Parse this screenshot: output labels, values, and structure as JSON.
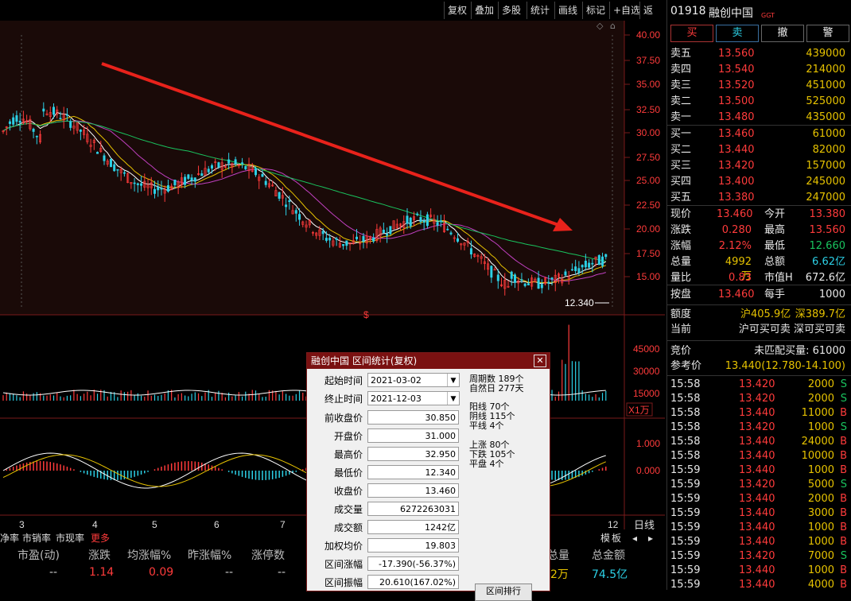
{
  "toolbar": {
    "items": [
      "复权",
      "叠加",
      "多股",
      "统计",
      "画线",
      "标记",
      "+自选",
      "返回"
    ]
  },
  "chart": {
    "price_axis": [
      "40.00",
      "37.50",
      "35.00",
      "32.50",
      "30.00",
      "27.50",
      "25.00",
      "22.50",
      "20.00",
      "17.50",
      "15.00"
    ],
    "last_price_label": "12.340",
    "marker": "$",
    "volume_axis": [
      "45000",
      "30000",
      "15000"
    ],
    "volume_unit": "X1万",
    "macd_axis": [
      "1.000",
      "0.000"
    ],
    "x_axis": [
      "3",
      "4",
      "5",
      "6",
      "7",
      "12"
    ],
    "period_label": "日线",
    "colors": {
      "up": "#ff3b3b",
      "down": "#2cd0e6",
      "ma5": "#ffffff",
      "ma10": "#e6c200",
      "ma20": "#c040c0",
      "ma60": "#19c35e"
    }
  },
  "bottom": {
    "tabs": [
      "净率",
      "市销率",
      "市现率",
      "更多"
    ],
    "right_tabs": [
      "模",
      "板"
    ],
    "headers": [
      "市盈(动)",
      "涨跌",
      "均涨幅%",
      "昨涨幅%",
      "涨停数",
      "总量",
      "总金额"
    ],
    "values": [
      "--",
      "1.14",
      "0.09",
      "--",
      "--",
      "2万",
      "74.5亿"
    ]
  },
  "dialog": {
    "title": "融创中国 区间统计(复权)",
    "start_label": "起始时间",
    "start_value": "2021-03-02",
    "end_label": "终止时间",
    "end_value": "2021-12-03",
    "rows": [
      {
        "label": "前收盘价",
        "value": "30.850"
      },
      {
        "label": "开盘价",
        "value": "31.000"
      },
      {
        "label": "最高价",
        "value": "32.950"
      },
      {
        "label": "最低价",
        "value": "12.340"
      },
      {
        "label": "收盘价",
        "value": "13.460"
      },
      {
        "label": "成交量",
        "value": "6272263031"
      },
      {
        "label": "成交额",
        "value": "1242亿"
      },
      {
        "label": "加权均价",
        "value": "19.803"
      },
      {
        "label": "区间涨幅",
        "value": "-17.390(-56.37%)"
      },
      {
        "label": "区间振幅",
        "value": "20.610(167.02%)"
      }
    ],
    "stats1": [
      "周期数 189个",
      "自然日 277天"
    ],
    "stats2": [
      "阳线 70个",
      "阴线 115个",
      "平线 4个"
    ],
    "stats3": [
      "上涨 80个",
      "下跌 105个",
      "平盘 4个"
    ],
    "button": "区间排行"
  },
  "right": {
    "code": "01918",
    "name": "融创中国",
    "tag": "GGT",
    "buttons": [
      "买",
      "卖",
      "撤",
      "警"
    ],
    "asks": [
      {
        "label": "卖五",
        "price": "13.560",
        "vol": "439000"
      },
      {
        "label": "卖四",
        "price": "13.540",
        "vol": "214000"
      },
      {
        "label": "卖三",
        "price": "13.520",
        "vol": "451000"
      },
      {
        "label": "卖二",
        "price": "13.500",
        "vol": "525000"
      },
      {
        "label": "卖一",
        "price": "13.480",
        "vol": "435000"
      }
    ],
    "bids": [
      {
        "label": "买一",
        "price": "13.460",
        "vol": "61000"
      },
      {
        "label": "买二",
        "price": "13.440",
        "vol": "82000"
      },
      {
        "label": "买三",
        "price": "13.420",
        "vol": "157000"
      },
      {
        "label": "买四",
        "price": "13.400",
        "vol": "245000"
      },
      {
        "label": "买五",
        "price": "13.380",
        "vol": "247000"
      }
    ],
    "quote": [
      {
        "l1": "现价",
        "v1": "13.460",
        "l2": "今开",
        "v2": "13.380"
      },
      {
        "l1": "涨跌",
        "v1": "0.280",
        "l2": "最高",
        "v2": "13.560"
      },
      {
        "l1": "涨幅",
        "v1": "2.12%",
        "l2": "最低",
        "v2": "12.660"
      },
      {
        "l1": "总量",
        "v1": "4992万",
        "l2": "总额",
        "v2": "6.62亿"
      },
      {
        "l1": "量比",
        "v1": "0.83",
        "l2": "市值H",
        "v2": "672.6亿"
      }
    ],
    "per_lot": {
      "l1": "按盘",
      "v1": "13.460",
      "l2": "每手",
      "v2": "1000"
    },
    "quota": {
      "label": "额度",
      "v1": "沪405.9亿",
      "v2": "深389.7亿"
    },
    "current": {
      "label": "当前",
      "value": "沪可买可卖 深可买可卖"
    },
    "auction": {
      "label": "竞价",
      "value": "未匹配买量: 61000"
    },
    "ref": {
      "label": "参考价",
      "value": "13.440(12.780-14.100)"
    },
    "ticks": [
      {
        "t": "15:58",
        "p": "13.420",
        "v": "2000",
        "s": "S"
      },
      {
        "t": "15:58",
        "p": "13.420",
        "v": "2000",
        "s": "S"
      },
      {
        "t": "15:58",
        "p": "13.440",
        "v": "11000",
        "s": "B"
      },
      {
        "t": "15:58",
        "p": "13.420",
        "v": "1000",
        "s": "S"
      },
      {
        "t": "15:58",
        "p": "13.440",
        "v": "24000",
        "s": "B"
      },
      {
        "t": "15:58",
        "p": "13.440",
        "v": "10000",
        "s": "B"
      },
      {
        "t": "15:59",
        "p": "13.440",
        "v": "1000",
        "s": "B"
      },
      {
        "t": "15:59",
        "p": "13.420",
        "v": "5000",
        "s": "S"
      },
      {
        "t": "15:59",
        "p": "13.440",
        "v": "2000",
        "s": "B"
      },
      {
        "t": "15:59",
        "p": "13.440",
        "v": "3000",
        "s": "B"
      },
      {
        "t": "15:59",
        "p": "13.440",
        "v": "1000",
        "s": "B"
      },
      {
        "t": "15:59",
        "p": "13.440",
        "v": "1000",
        "s": "B"
      },
      {
        "t": "15:59",
        "p": "13.420",
        "v": "7000",
        "s": "S"
      },
      {
        "t": "15:59",
        "p": "13.440",
        "v": "1000",
        "s": "B"
      },
      {
        "t": "15:59",
        "p": "13.440",
        "v": "4000",
        "s": "B"
      }
    ]
  }
}
